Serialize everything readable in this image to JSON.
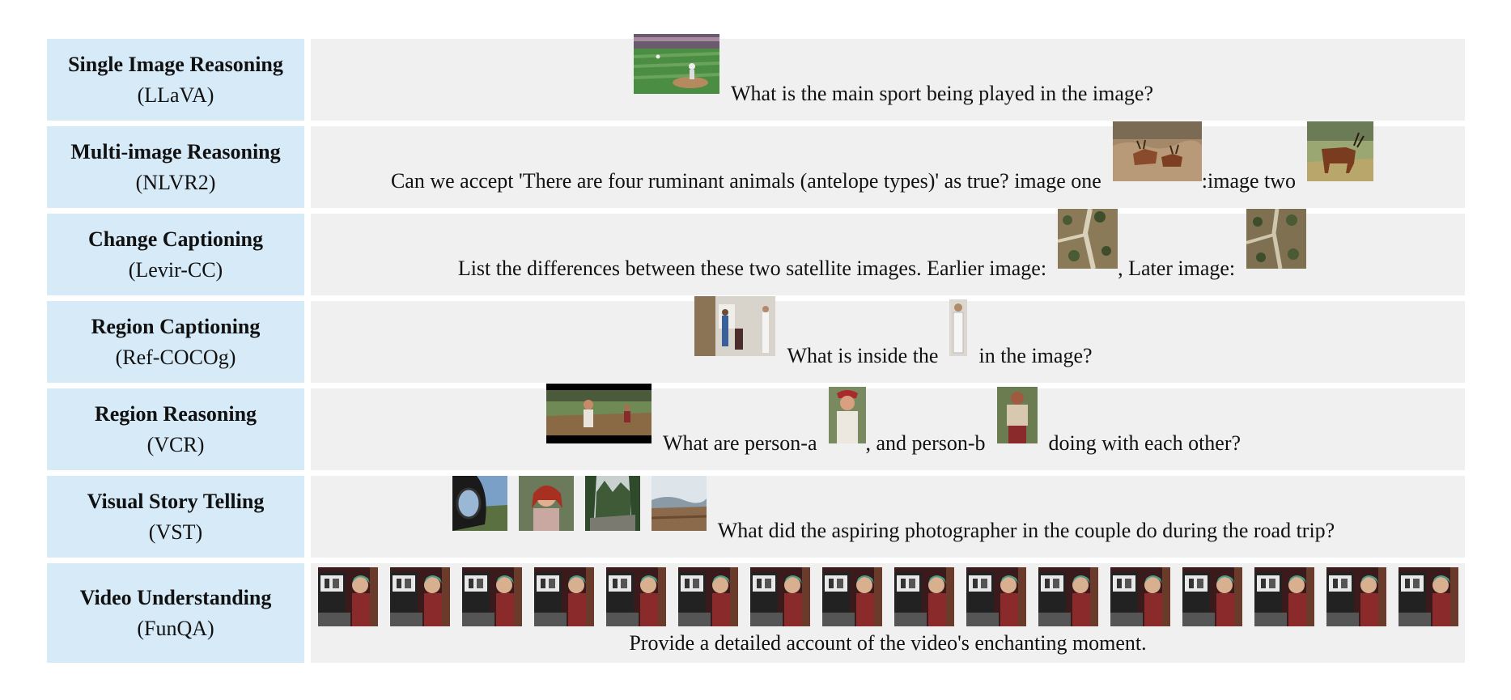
{
  "rows": [
    {
      "task": "Single Image Reasoning",
      "dataset": "(LLaVA)",
      "before": "",
      "after": "What is the main sport being played in the image?"
    },
    {
      "task": "Multi-image Reasoning",
      "dataset": "(NLVR2)",
      "text1": "Can we accept 'There are four ruminant animals (antelope types)' as true? image one",
      "text2": ":image two"
    },
    {
      "task": "Change Captioning",
      "dataset": "(Levir-CC)",
      "text1": "List the differences between these two satellite images. Earlier image:",
      "text2": ", Later image:"
    },
    {
      "task": "Region Captioning",
      "dataset": "(Ref-COCOg)",
      "text1": "What is inside the",
      "text2": "in the image?"
    },
    {
      "task": "Region Reasoning",
      "dataset": "(VCR)",
      "text1": "What are person-a",
      "text2": ", and person-b",
      "text3": "doing with each other?"
    },
    {
      "task": "Visual Story Telling",
      "dataset": "(VST)",
      "text1": "What did the aspiring photographer in the couple do during the road trip?"
    },
    {
      "task": "Video Understanding",
      "dataset": "(FunQA)",
      "text1": "Provide a detailed account of the video's enchanting moment."
    }
  ],
  "colors": {
    "task_bg": "#d6eaf8",
    "content_bg": "#f0f0f0"
  },
  "icons": [
    "baseball-photo",
    "antelope-photo",
    "satellite-photo",
    "room-photo",
    "person-crop-photo",
    "movie-still-photo",
    "story-photo",
    "video-frame"
  ]
}
